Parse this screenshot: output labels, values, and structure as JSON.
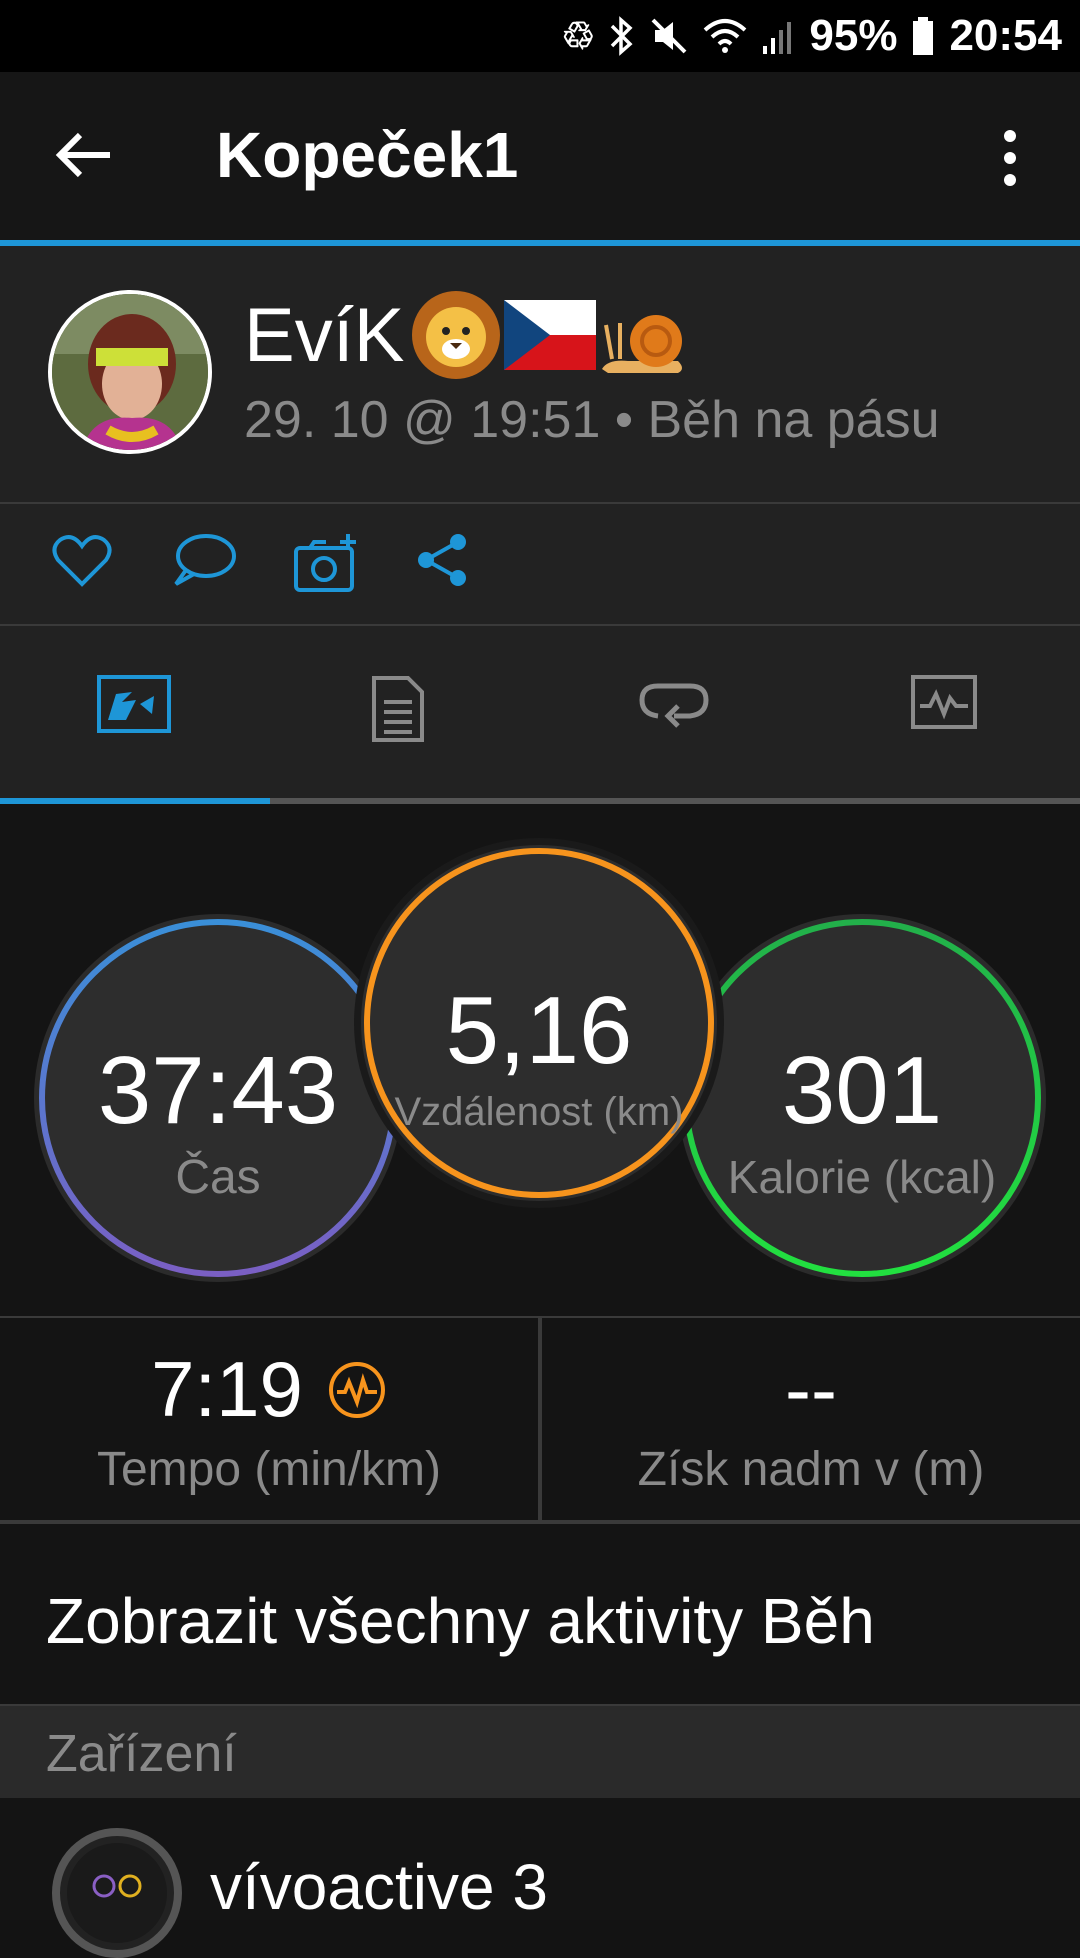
{
  "status": {
    "battery": "95%",
    "time": "20:54"
  },
  "appbar": {
    "title": "Kopeček1"
  },
  "header": {
    "user_name": "EvíK",
    "meta": "29. 10 @ 19:51 • Běh na pásu"
  },
  "actions": [
    {
      "icon": "heart-icon"
    },
    {
      "icon": "comment-icon"
    },
    {
      "icon": "add-photo-icon"
    },
    {
      "icon": "share-icon"
    }
  ],
  "tabs": [
    {
      "icon": "map-summary-icon",
      "active": true
    },
    {
      "icon": "document-list-icon",
      "active": false
    },
    {
      "icon": "laps-icon",
      "active": false
    },
    {
      "icon": "chart-icon",
      "active": false
    }
  ],
  "stats": {
    "time": {
      "value": "37:43",
      "label": "Čas"
    },
    "distance": {
      "value": "5,16",
      "label": "Vzdálenost (km)"
    },
    "calories": {
      "value": "301",
      "label": "Kalorie (kcal)"
    }
  },
  "metrics": {
    "pace": {
      "value": "7:19",
      "label": "Tempo (min/km)"
    },
    "elevation": {
      "value": "--",
      "label": "Získ nadm v (m)"
    }
  },
  "link": {
    "text": "Zobrazit všechny aktivity Běh"
  },
  "devices": {
    "section_title": "Zařízení",
    "name": "vívoactive 3"
  },
  "colors": {
    "accent": "#1e96d7",
    "orange": "#f7941d",
    "green": "#22c845",
    "blue": "#3a8fd8",
    "purple": "#7a5fc4"
  }
}
